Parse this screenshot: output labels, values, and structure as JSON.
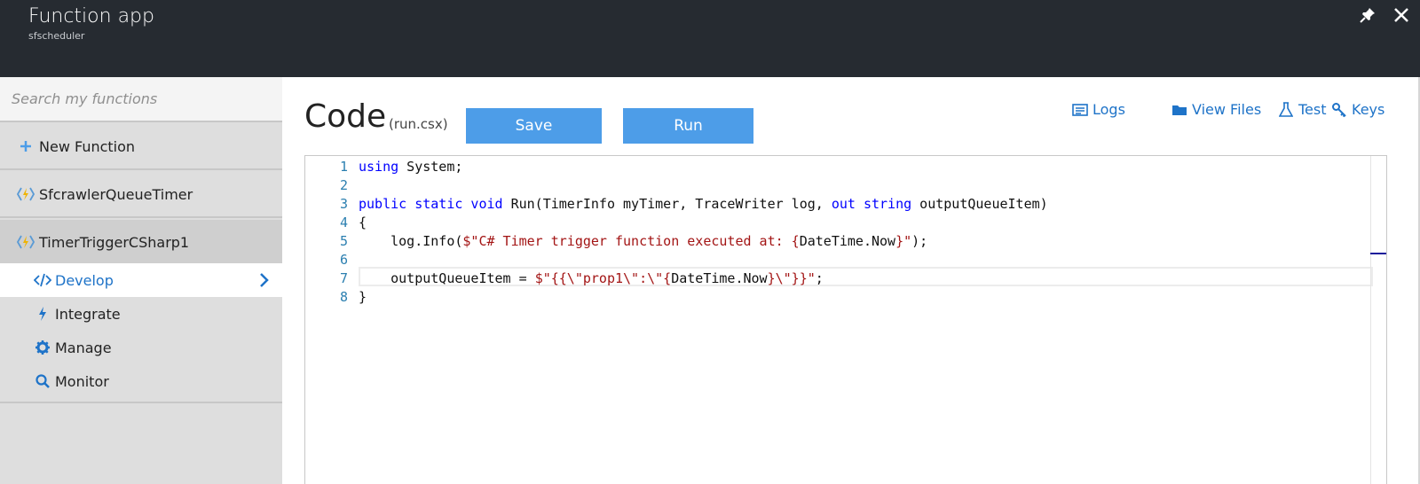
{
  "header": {
    "title": "Function app",
    "subtitle": "sfscheduler",
    "pin_icon": "pin-icon",
    "close_icon": "close-icon"
  },
  "sidebar": {
    "search_placeholder": "Search my functions",
    "new_function_label": "New Function",
    "functions": [
      {
        "label": "SfcrawlerQueueTimer",
        "icon": "function-bolt-icon"
      },
      {
        "label": "TimerTriggerCSharp1",
        "icon": "function-bolt-icon"
      }
    ],
    "subitems": [
      {
        "label": "Develop",
        "icon": "code-icon",
        "selected": true
      },
      {
        "label": "Integrate",
        "icon": "lightning-icon"
      },
      {
        "label": "Manage",
        "icon": "gear-icon"
      },
      {
        "label": "Monitor",
        "icon": "search-icon"
      }
    ]
  },
  "main": {
    "title": "Code",
    "file": "(run.csx)",
    "save_label": "Save",
    "run_label": "Run",
    "links": {
      "logs": "Logs",
      "view_files": "View Files",
      "test": "Test",
      "keys": "Keys"
    }
  },
  "editor": {
    "lines": [
      {
        "n": "1"
      },
      {
        "n": "2"
      },
      {
        "n": "3"
      },
      {
        "n": "4"
      },
      {
        "n": "5"
      },
      {
        "n": "6"
      },
      {
        "n": "7"
      },
      {
        "n": "8"
      }
    ],
    "code": {
      "l1_kw": "using",
      "l1_rest": " System;",
      "l3_kw": "public static void",
      "l3_a": " Run(TimerInfo myTimer, TraceWriter log, ",
      "l3_kw2": "out string",
      "l3_b": " outputQueueItem)",
      "l4": "{",
      "l5_a": "    log.Info(",
      "l5_str": "$\"C# Timer trigger function executed at: {",
      "l5_b": "DateTime.Now",
      "l5_str2": "}\"",
      "l5_c": ");",
      "l7_a": "    outputQueueItem = ",
      "l7_str": "$\"{{\\\"prop1\\\":\\\"{",
      "l7_b": "DateTime.Now",
      "l7_str2": "}\\\"}}\"",
      "l7_c": ";",
      "l8": "}"
    }
  },
  "colors": {
    "header_bg": "#262b31",
    "accent": "#4d9de8",
    "link": "#1e73c8",
    "keyword": "#0000ff",
    "string": "#a31515"
  }
}
